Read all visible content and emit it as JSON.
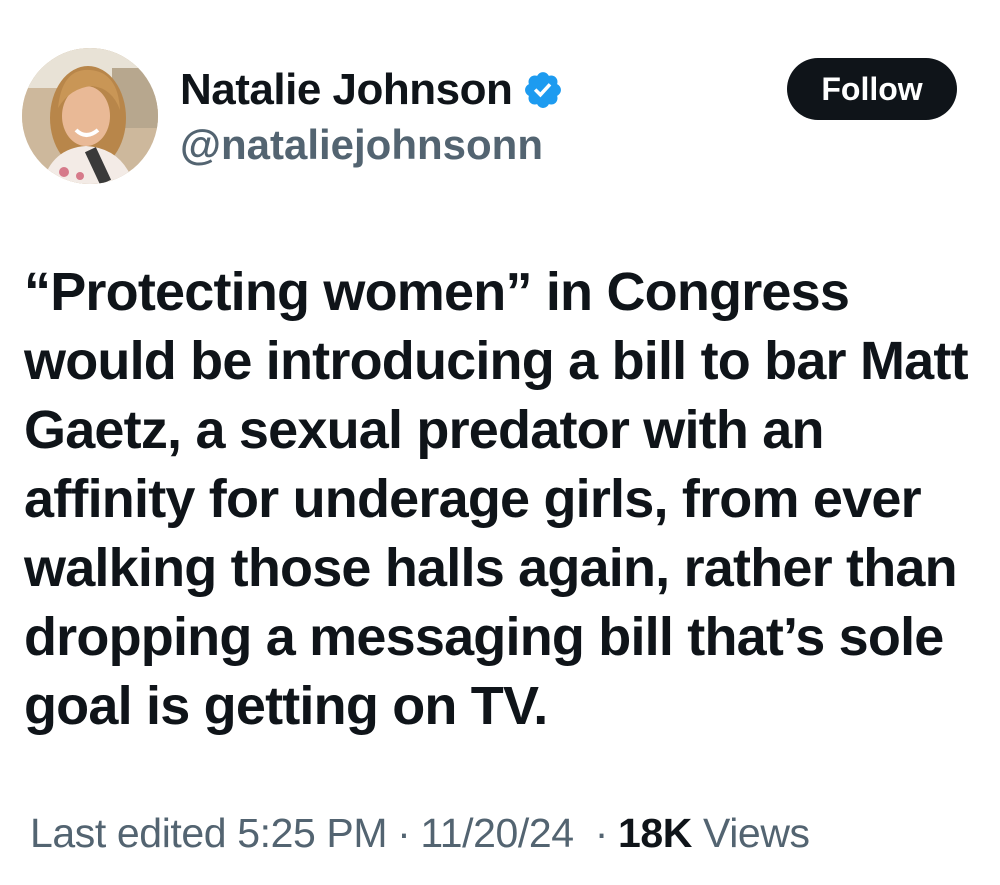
{
  "author": {
    "display_name": "Natalie Johnson",
    "handle": "@nataliejohnsonn",
    "verified": true,
    "verified_icon": "verified-badge-icon",
    "verified_color": "#1d9bf0"
  },
  "follow_button": {
    "label": "Follow"
  },
  "tweet": {
    "lines": [
      "“Protecting women” in Congress",
      "would be introducing a bill to bar Matt",
      "Gaetz, a sexual predator with an",
      "affinity for underage girls, from ever",
      "walking those halls again, rather than",
      "dropping a messaging bill that’s sole",
      "goal is getting on TV."
    ]
  },
  "meta": {
    "edited_label": "Last edited",
    "time": "5:25 PM",
    "date": "11/20/24",
    "separator": "·",
    "views_count": "18K",
    "views_label": "Views"
  },
  "colors": {
    "text_primary": "#0f1419",
    "text_secondary": "#536471",
    "button_bg": "#0f1419",
    "button_text": "#ffffff"
  }
}
